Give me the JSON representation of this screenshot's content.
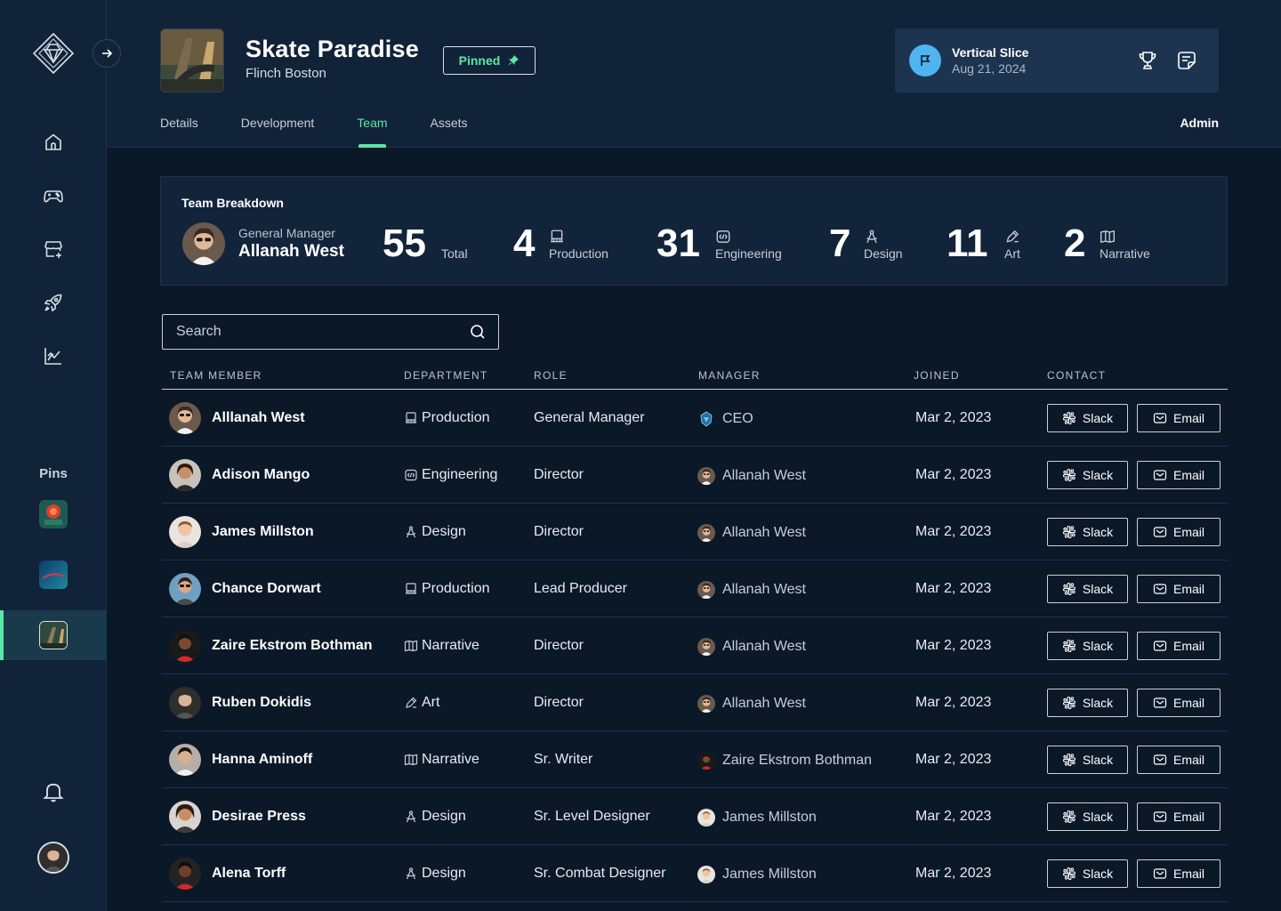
{
  "sidebar": {
    "nav": [
      "home-icon",
      "gamepad-icon",
      "store-icon",
      "rocket-icon",
      "analytics-icon"
    ],
    "pins_label": "Pins"
  },
  "project": {
    "title": "Skate Paradise",
    "studio": "Flinch Boston",
    "pinned_label": "Pinned"
  },
  "milestone": {
    "name": "Vertical Slice",
    "date": "Aug 21, 2024"
  },
  "tabs": [
    "Details",
    "Development",
    "Team",
    "Assets"
  ],
  "active_tab": "Team",
  "admin_label": "Admin",
  "breakdown": {
    "title": "Team Breakdown",
    "gm_role": "General Manager",
    "gm_name": "Allanah West",
    "total": {
      "value": "55",
      "label": "Total"
    },
    "stats": [
      {
        "value": "4",
        "label": "Production"
      },
      {
        "value": "31",
        "label": "Engineering"
      },
      {
        "value": "7",
        "label": "Design"
      },
      {
        "value": "11",
        "label": "Art"
      },
      {
        "value": "2",
        "label": "Narrative"
      }
    ]
  },
  "search": {
    "placeholder": "Search"
  },
  "table": {
    "headers": [
      "TEAM MEMBER",
      "DEPARTMENT",
      "ROLE",
      "MANAGER",
      "JOINED",
      "CONTACT"
    ],
    "slack_label": "Slack",
    "email_label": "Email",
    "rows": [
      {
        "name": "Alllanah West",
        "dept": "Production",
        "role": "General Manager",
        "manager": "CEO",
        "joined": "Mar 2, 2023"
      },
      {
        "name": "Adison Mango",
        "dept": "Engineering",
        "role": "Director",
        "manager": "Allanah West",
        "joined": "Mar 2, 2023"
      },
      {
        "name": "James Millston",
        "dept": "Design",
        "role": "Director",
        "manager": "Allanah West",
        "joined": "Mar 2, 2023"
      },
      {
        "name": "Chance Dorwart",
        "dept": "Production",
        "role": "Lead Producer",
        "manager": "Allanah West",
        "joined": "Mar 2, 2023"
      },
      {
        "name": "Zaire Ekstrom Bothman",
        "dept": "Narrative",
        "role": "Director",
        "manager": "Allanah West",
        "joined": "Mar 2, 2023"
      },
      {
        "name": "Ruben Dokidis",
        "dept": "Art",
        "role": "Director",
        "manager": "Allanah West",
        "joined": "Mar 2, 2023"
      },
      {
        "name": "Hanna Aminoff",
        "dept": "Narrative",
        "role": "Sr. Writer",
        "manager": "Zaire Ekstrom Bothman",
        "joined": "Mar 2, 2023"
      },
      {
        "name": "Desirae Press",
        "dept": "Design",
        "role": "Sr. Level Designer",
        "manager": "James Millston",
        "joined": "Mar 2, 2023"
      },
      {
        "name": "Alena Torff",
        "dept": "Design",
        "role": "Sr. Combat Designer",
        "manager": "James Millston",
        "joined": "Mar 2, 2023"
      }
    ]
  },
  "colors": {
    "accent": "#5ee6a8",
    "flag": "#4fb4f0",
    "background": "#0b1828",
    "panel": "#112339"
  }
}
